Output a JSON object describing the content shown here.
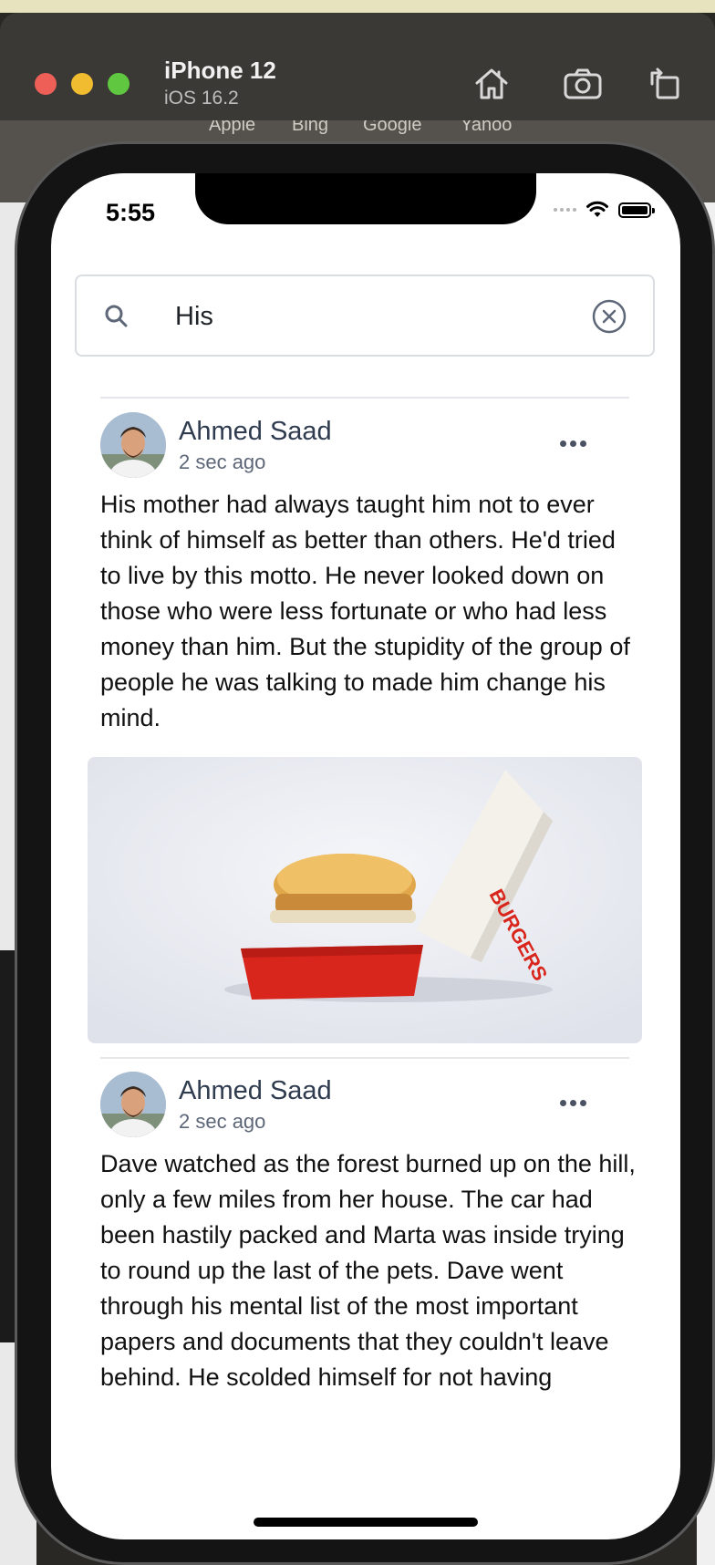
{
  "simulator": {
    "device_name": "iPhone 12",
    "os_version": "iOS 16.2",
    "toolbar_icons": [
      "home-icon",
      "screenshot-icon",
      "rotate-icon"
    ]
  },
  "background_bookmarks": [
    "Apple",
    "Bing",
    "Google",
    "Yahoo"
  ],
  "status_bar": {
    "time": "5:55"
  },
  "search": {
    "value": "His",
    "placeholder": ""
  },
  "posts": [
    {
      "author": "Ahmed Saad",
      "time": "2 sec ago",
      "text": "His mother had always taught him not to ever think of himself as better than others. He'd tried to live by this motto. He never looked down on those who were less fortunate or who had less money than him. But the stupidity of the group of people he was talking to made him change his mind.",
      "image": {
        "box_text": "BURGERS"
      }
    },
    {
      "author": "Ahmed Saad",
      "time": "2 sec ago",
      "text": "Dave watched as the forest burned up on the hill, only a few miles from her house. The car had been hastily packed and Marta was inside trying to round up the last of the pets. Dave went through his mental list of the most important papers and documents that they couldn't leave behind. He scolded himself for not having"
    }
  ],
  "colors": {
    "author_text": "#2f3b4f",
    "accent_red": "#d9261c",
    "window_bar": "#3b3935"
  }
}
